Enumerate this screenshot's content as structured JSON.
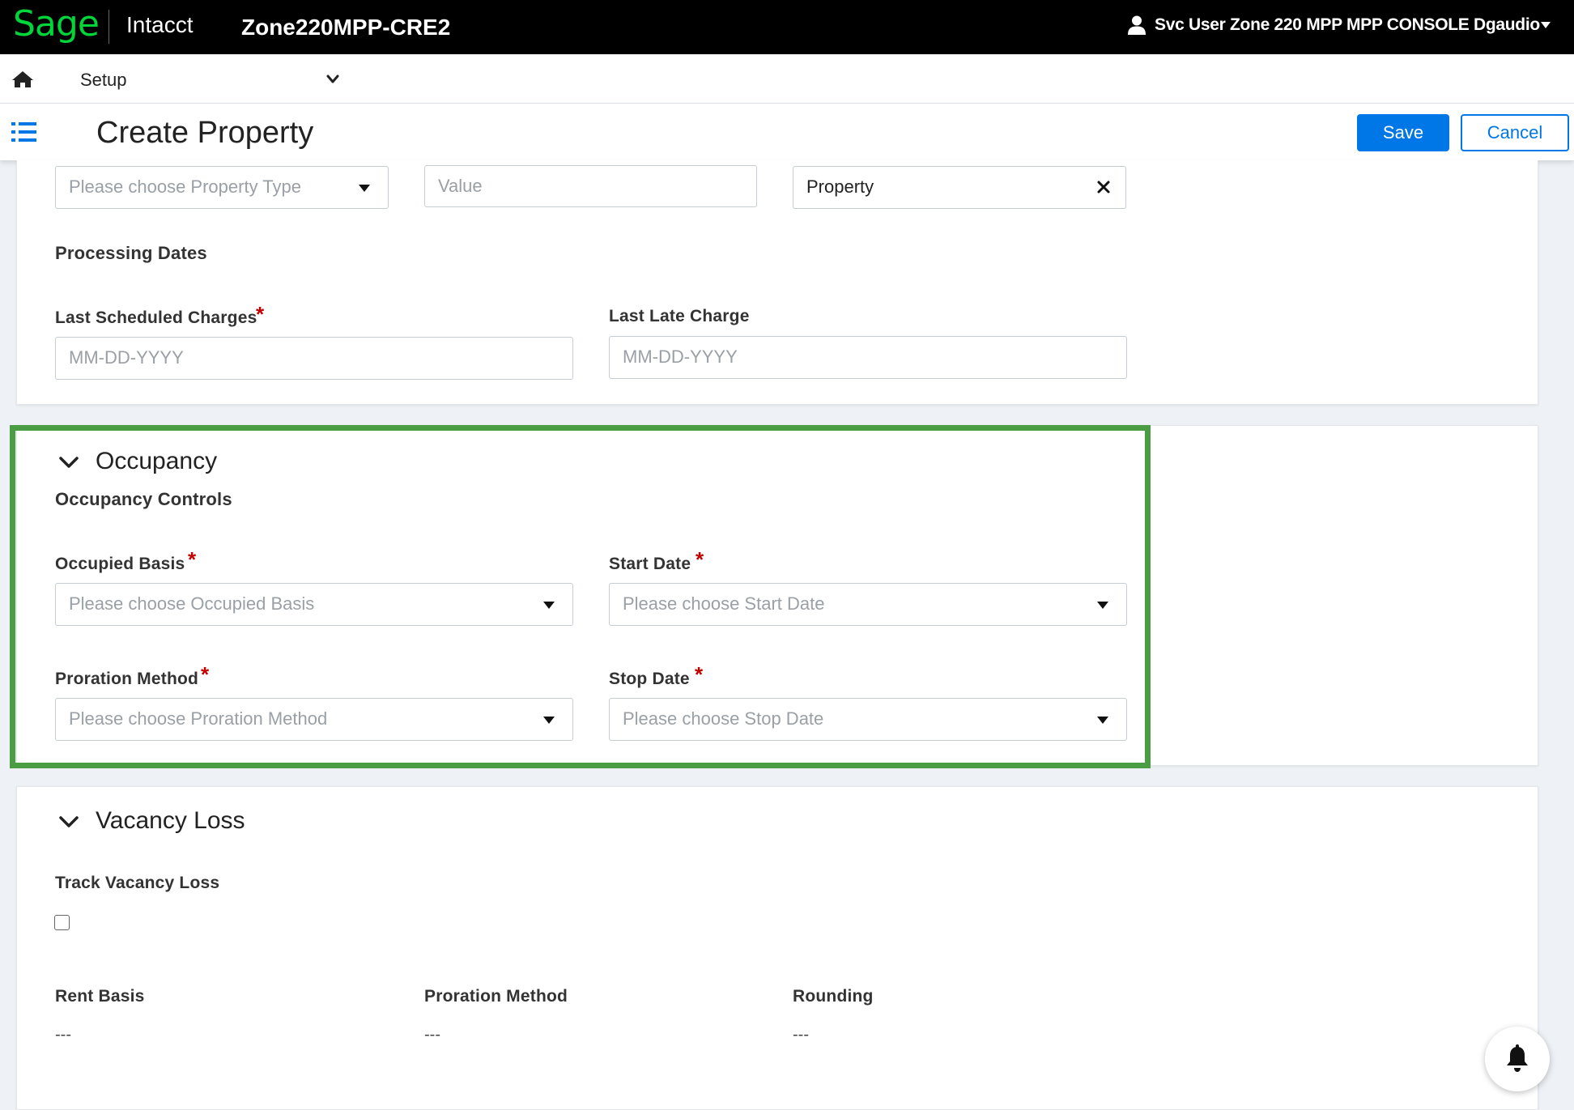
{
  "header": {
    "logo": "Sage",
    "product": "Intacct",
    "company": "Zone220MPP-CRE2",
    "user": "Svc User Zone 220 MPP MPP CONSOLE Dgaudio"
  },
  "nav": {
    "module": "Setup"
  },
  "titlebar": {
    "title": "Create Property",
    "save_label": "Save",
    "cancel_label": "Cancel"
  },
  "property_section": {
    "property_type_placeholder": "Please choose Property Type",
    "value_placeholder": "Value",
    "entity_value": "Property",
    "processing_dates_title": "Processing Dates",
    "last_scheduled_charges_label": "Last Scheduled Charges",
    "last_scheduled_charges_placeholder": "MM-DD-YYYY",
    "last_late_charge_label": "Last Late Charge",
    "last_late_charge_placeholder": "MM-DD-YYYY"
  },
  "occupancy": {
    "title": "Occupancy",
    "controls_title": "Occupancy Controls",
    "occupied_basis_label": "Occupied Basis",
    "occupied_basis_placeholder": "Please choose Occupied Basis",
    "start_date_label": "Start Date",
    "start_date_placeholder": "Please choose Start Date",
    "proration_method_label": "Proration Method",
    "proration_method_placeholder": "Please choose Proration Method",
    "stop_date_label": "Stop Date",
    "stop_date_placeholder": "Please choose Stop Date",
    "required_marker": "*"
  },
  "vacancy_loss": {
    "title": "Vacancy Loss",
    "track_label": "Track Vacancy Loss",
    "track_checked": false,
    "rent_basis_label": "Rent Basis",
    "rent_basis_value": "---",
    "proration_method_label": "Proration Method",
    "proration_method_value": "---",
    "rounding_label": "Rounding",
    "rounding_value": "---"
  },
  "colors": {
    "accent": "#0077e6",
    "brand_green": "#00d639",
    "highlight": "#4b9d44",
    "required": "#c00000"
  }
}
